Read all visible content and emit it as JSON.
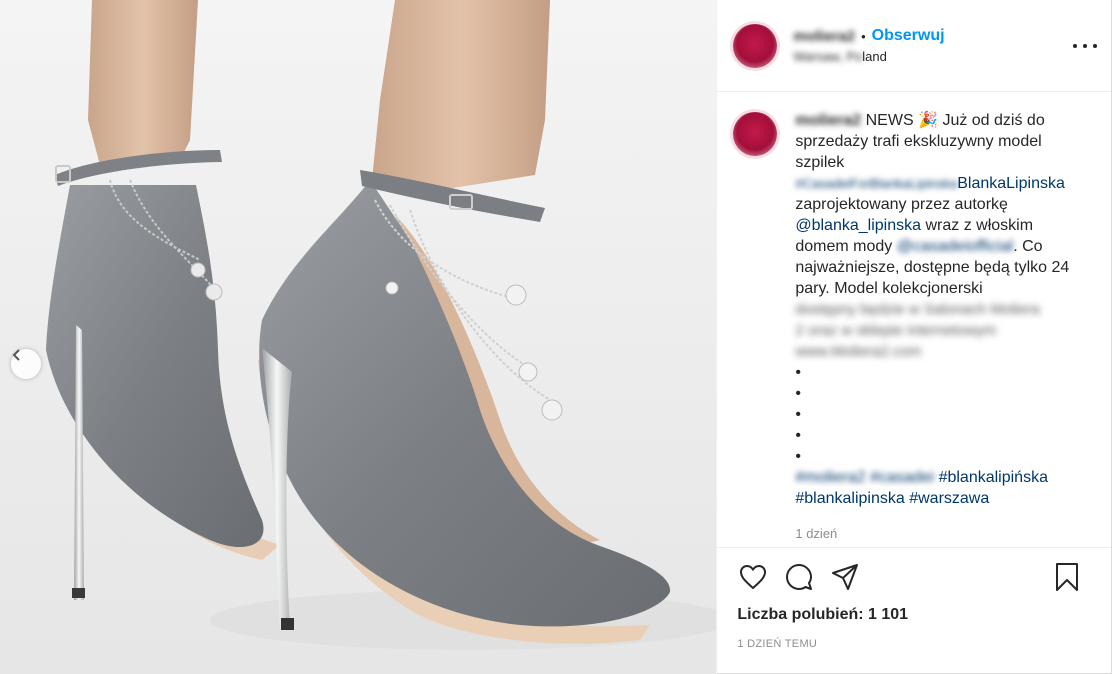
{
  "header": {
    "username": "moliera2",
    "separator": "•",
    "follow_label": "Obserwuj",
    "location_blurred": "Warsaw, Po",
    "location_visible": "land"
  },
  "caption": {
    "username": "moliera2",
    "text_1": "NEWS 🎉 Już od dziś do sprzedaży trafi ekskluzywny model szpilek ",
    "tag_blurred_1": "#CasadeiForBlankaLipinska",
    "tag_visible_1": "BlankaLipinska",
    "text_2": " zaprojektowany przez autorkę ",
    "mention": "@blanka_lipinska",
    "text_3": " wraz z włoskim domem mody ",
    "mention_blurred": "@casadeiofficial",
    "text_4": ". Co najważniejsze, dostępne będą tylko 24 pary. Model kolekcjonerski",
    "blurred_lines": [
      "dostępny będzie w Salonach Moliera",
      "2 oraz w sklepie internetowym",
      "www.Moliera2.com"
    ],
    "bullets": [
      "•",
      "•",
      "•",
      "•",
      "•"
    ],
    "tags_blurred": "#moliera2 #casadei",
    "tag_1": "#blankalipińska",
    "tag_2": "#blankalipinska",
    "tag_3": "#warszawa",
    "time": "1 dzień"
  },
  "actions": {
    "likes": "Liczba polubień: 1 101",
    "timestamp": "1 DZIEŃ TEMU"
  },
  "icons": {
    "like": "heart-icon",
    "comment": "comment-icon",
    "share": "paper-plane-icon",
    "save": "bookmark-icon",
    "prev": "chevron-left-icon",
    "more": "more-options-icon"
  }
}
